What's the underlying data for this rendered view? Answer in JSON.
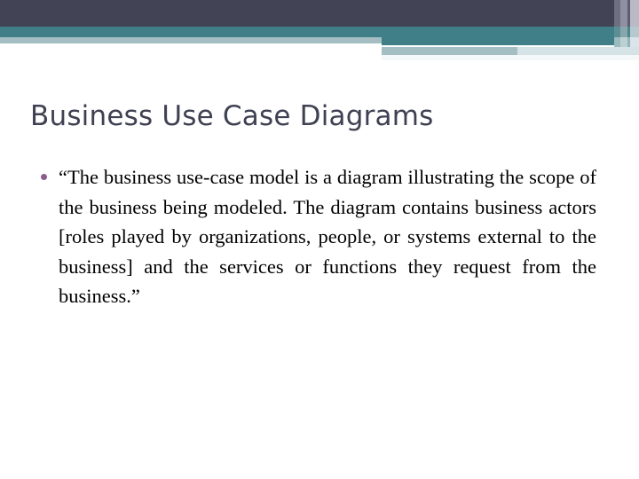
{
  "slide": {
    "title": "Business Use Case Diagrams",
    "body": {
      "bullets": [
        "“The business use-case model is a diagram illustrating the scope of the business being modeled. The diagram contains business actors [roles played by organizations, people, or systems external to the business] and the services or functions they request from the business.”"
      ],
      "bullet_glyph": "•"
    },
    "colors": {
      "title_text": "#3f4152",
      "body_text": "#000000",
      "bullet": "#8d5b8d",
      "band_dark": "#424455",
      "band_teal": "#417f88",
      "band_pale": "#a4bec3",
      "band_pale_fade": "#d5e3e6",
      "background": "#ffffff"
    }
  }
}
